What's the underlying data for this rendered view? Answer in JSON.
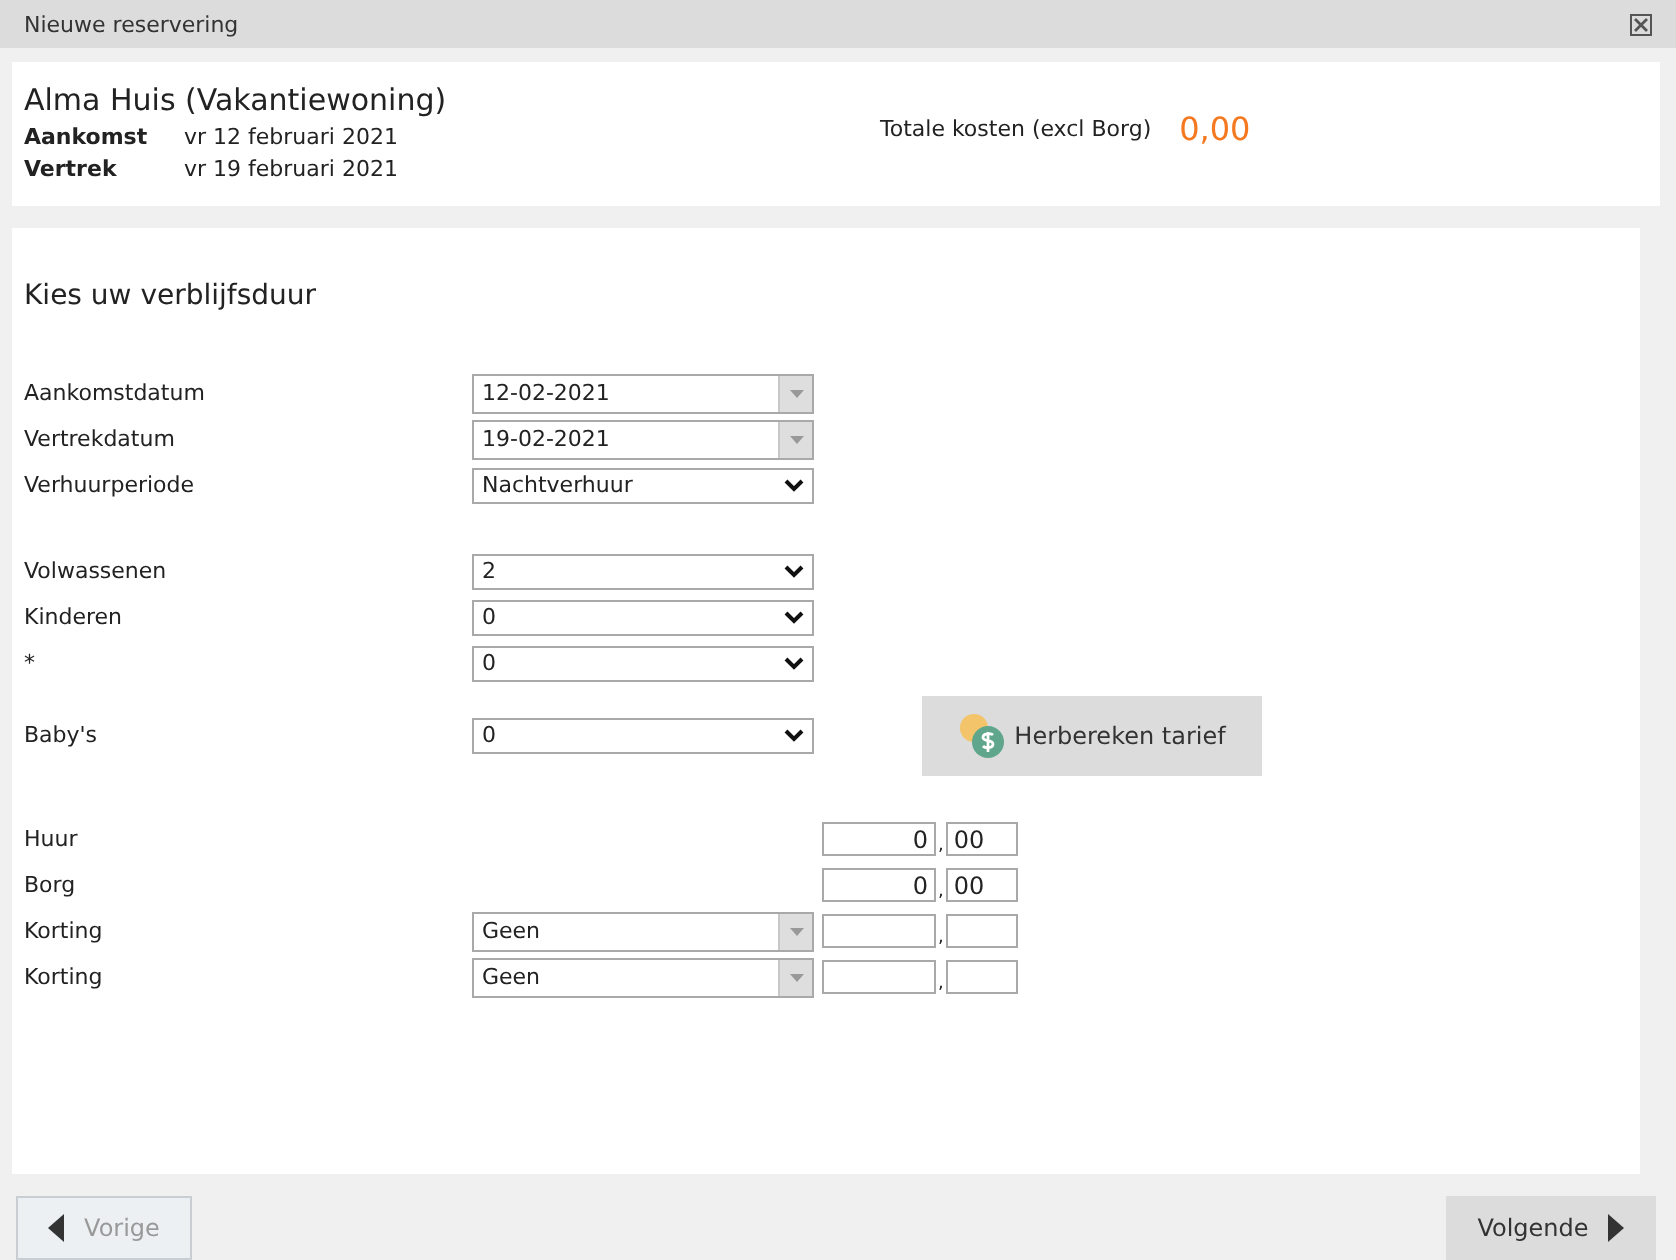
{
  "window": {
    "title": "Nieuwe reservering"
  },
  "header": {
    "property": "Alma Huis (Vakantiewoning)",
    "arrival_label": "Aankomst",
    "arrival": "vr 12 februari 2021",
    "departure_label": "Vertrek",
    "departure": "vr 19 februari 2021",
    "total_label": "Totale kosten (excl Borg)",
    "total": "0,00"
  },
  "form": {
    "title": "Kies uw verblijfsduur",
    "groups": [
      {
        "rows": [
          {
            "kind": "date",
            "label": "Aankomstdatum",
            "value": "12-02-2021"
          },
          {
            "kind": "date",
            "label": "Vertrekdatum",
            "value": "19-02-2021"
          },
          {
            "kind": "select",
            "label": "Verhuurperiode",
            "value": "Nachtverhuur"
          }
        ]
      },
      {
        "rows": [
          {
            "kind": "select",
            "label": "Volwassenen",
            "value": "2"
          },
          {
            "kind": "select",
            "label": "Kinderen",
            "value": "0"
          },
          {
            "kind": "select",
            "label": "*",
            "value": "0"
          }
        ]
      },
      {
        "rows": [
          {
            "kind": "select",
            "label": "Baby's",
            "value": "0"
          }
        ],
        "action": "Herbereken tarief"
      },
      {
        "rows": [
          {
            "kind": "amount",
            "label": "Huur",
            "whole": "0",
            "decimals": "00",
            "separator": ","
          },
          {
            "kind": "amount",
            "label": "Borg",
            "whole": "0",
            "decimals": "00",
            "separator": ","
          },
          {
            "kind": "discount",
            "label": "Korting",
            "value": "Geen",
            "separator": ","
          },
          {
            "kind": "discount",
            "label": "Korting",
            "value": "Geen",
            "separator": ","
          }
        ]
      }
    ]
  },
  "footer": {
    "previous": {
      "label": "Vorige",
      "disabled": true
    },
    "next": {
      "label": "Volgende",
      "disabled": false
    }
  }
}
